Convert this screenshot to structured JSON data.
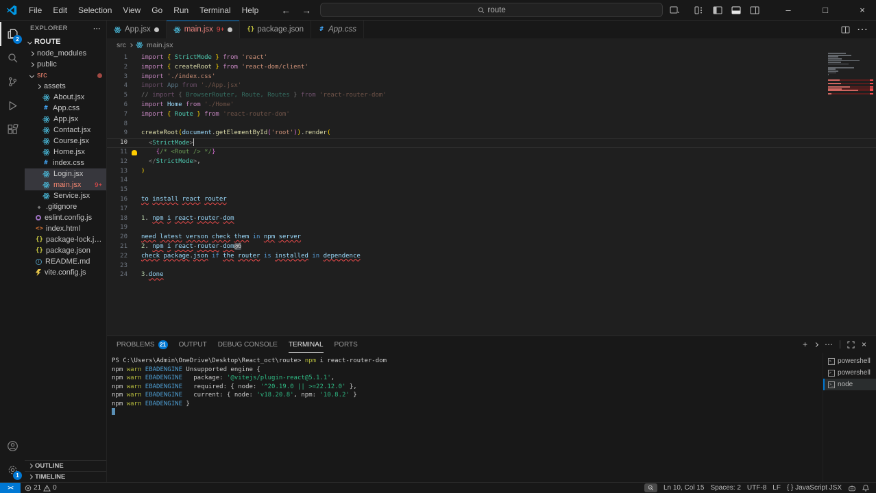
{
  "title_bar": {
    "menus": [
      "File",
      "Edit",
      "Selection",
      "View",
      "Go",
      "Run",
      "Terminal",
      "Help"
    ],
    "search_value": "route"
  },
  "activity_bar": {
    "explorer_badge": "2",
    "settings_badge": "1"
  },
  "sidebar": {
    "header": "EXPLORER",
    "root": "ROUTE",
    "files": [
      {
        "label": "node_modules",
        "icon": "chev",
        "indent": 0,
        "folder": true
      },
      {
        "label": "public",
        "icon": "chev",
        "indent": 0,
        "folder": true
      },
      {
        "label": "src",
        "icon": "chev-open",
        "indent": 0,
        "folder": true,
        "color": "red",
        "dot": true
      },
      {
        "label": "assets",
        "icon": "chev",
        "indent": 1,
        "folder": true
      },
      {
        "label": "About.jsx",
        "icon": "react",
        "indent": 1
      },
      {
        "label": "App.css",
        "icon": "css",
        "indent": 1
      },
      {
        "label": "App.jsx",
        "icon": "react",
        "indent": 1
      },
      {
        "label": "Contact.jsx",
        "icon": "react",
        "indent": 1
      },
      {
        "label": "Course.jsx",
        "icon": "react",
        "indent": 1
      },
      {
        "label": "Home.jsx",
        "icon": "react",
        "indent": 1
      },
      {
        "label": "index.css",
        "icon": "css",
        "indent": 1
      },
      {
        "label": "Login.jsx",
        "icon": "react",
        "indent": 1,
        "selected": true,
        "color": "red2"
      },
      {
        "label": "main.jsx",
        "icon": "react",
        "indent": 1,
        "selected": true,
        "color": "red",
        "badge": "9+"
      },
      {
        "label": "Service.jsx",
        "icon": "react",
        "indent": 1
      },
      {
        "label": ".gitignore",
        "icon": "git",
        "indent": 0
      },
      {
        "label": "eslint.config.js",
        "icon": "eslint",
        "indent": 0
      },
      {
        "label": "index.html",
        "icon": "html",
        "indent": 0
      },
      {
        "label": "package-lock.json",
        "icon": "json",
        "indent": 0
      },
      {
        "label": "package.json",
        "icon": "json",
        "indent": 0
      },
      {
        "label": "README.md",
        "icon": "md",
        "indent": 0
      },
      {
        "label": "vite.config.js",
        "icon": "vite",
        "indent": 0
      }
    ],
    "sections": [
      "OUTLINE",
      "TIMELINE"
    ]
  },
  "tabs": [
    {
      "label": "App.jsx",
      "icon": "react",
      "modified": true
    },
    {
      "label": "main.jsx",
      "icon": "react",
      "badge": "9+",
      "modified": true,
      "active": true,
      "error": true
    },
    {
      "label": "package.json",
      "icon": "json"
    },
    {
      "label": "App.css",
      "icon": "css",
      "preview": true
    }
  ],
  "breadcrumb": {
    "folder": "src",
    "file": "main.jsx"
  },
  "editor": {
    "lines": [
      {
        "n": 1,
        "s": [
          [
            "import ",
            "kw"
          ],
          [
            "{ ",
            "b1"
          ],
          [
            "StrictMode ",
            "cls"
          ],
          [
            "} ",
            "b1"
          ],
          [
            "from ",
            "kw"
          ],
          [
            "'react'",
            "str"
          ]
        ]
      },
      {
        "n": 2,
        "s": [
          [
            "import ",
            "kw"
          ],
          [
            "{ ",
            "b1"
          ],
          [
            "createRoot ",
            "fn"
          ],
          [
            "} ",
            "b1"
          ],
          [
            "from ",
            "kw"
          ],
          [
            "'react-dom/client'",
            "str"
          ]
        ]
      },
      {
        "n": 3,
        "s": [
          [
            "import ",
            "kw"
          ],
          [
            "'./index.css'",
            "str"
          ]
        ]
      },
      {
        "n": 4,
        "s": [
          [
            "import ",
            "kw dim"
          ],
          [
            "App ",
            "var dim"
          ],
          [
            "from ",
            "kw dim"
          ],
          [
            "'./App.jsx'",
            "str dim"
          ]
        ]
      },
      {
        "n": 5,
        "s": [
          [
            "// ",
            "p dim"
          ],
          [
            "import ",
            "kw dim"
          ],
          [
            "{ ",
            "p dim"
          ],
          [
            "BrowserRouter, Route, Routes",
            "cls dim"
          ],
          [
            " } ",
            "p dim"
          ],
          [
            "from ",
            "kw dim"
          ],
          [
            "'react-router-dom'",
            "str dim"
          ]
        ]
      },
      {
        "n": 6,
        "s": [
          [
            "import ",
            "kw"
          ],
          [
            "Home ",
            "var"
          ],
          [
            "from ",
            "kw"
          ],
          [
            "'./Home'",
            "str dim"
          ]
        ]
      },
      {
        "n": 7,
        "s": [
          [
            "import ",
            "kw"
          ],
          [
            "{ ",
            "b1"
          ],
          [
            "Route ",
            "cls"
          ],
          [
            "} ",
            "b1"
          ],
          [
            "from ",
            "kw"
          ],
          [
            "'react-router-dom'",
            "str dim"
          ]
        ]
      },
      {
        "n": 8,
        "s": []
      },
      {
        "n": 9,
        "s": [
          [
            "createRoot",
            "fn"
          ],
          [
            "(",
            "b1"
          ],
          [
            "document",
            "var"
          ],
          [
            ".",
            "p"
          ],
          [
            "getElementById",
            "fn"
          ],
          [
            "(",
            "b2"
          ],
          [
            "'root'",
            "str"
          ],
          [
            ")",
            "b2"
          ],
          [
            ")",
            "b1"
          ],
          [
            ".",
            "p"
          ],
          [
            "render",
            "fn"
          ],
          [
            "(",
            "b1"
          ]
        ]
      },
      {
        "n": 10,
        "cur": true,
        "caret": true,
        "s": [
          [
            "  ",
            "p"
          ],
          [
            "<",
            "tag"
          ],
          [
            "StrictMode",
            "cls"
          ],
          [
            ">",
            "tag"
          ]
        ]
      },
      {
        "n": 11,
        "bulb": true,
        "s": [
          [
            "    ",
            "p"
          ],
          [
            "{",
            "b2"
          ],
          [
            "/* ",
            "cm"
          ],
          [
            "<Rout /> ",
            "cm"
          ],
          [
            "*/",
            "cm"
          ],
          [
            "}",
            "b2"
          ]
        ]
      },
      {
        "n": 12,
        "s": [
          [
            "  ",
            "p"
          ],
          [
            "</",
            "tag"
          ],
          [
            "StrictMode",
            "cls"
          ],
          [
            ">",
            "tag"
          ],
          [
            ",",
            "p"
          ]
        ]
      },
      {
        "n": 13,
        "s": [
          [
            ")",
            "b1"
          ]
        ]
      },
      {
        "n": 14,
        "s": []
      },
      {
        "n": 15,
        "s": []
      },
      {
        "n": 16,
        "s": [
          [
            "to",
            "var sq"
          ],
          [
            " ",
            "p"
          ],
          [
            "install",
            "var sq"
          ],
          [
            " ",
            "p"
          ],
          [
            "react",
            "var sq"
          ],
          [
            " ",
            "p"
          ],
          [
            "router",
            "var sq"
          ]
        ]
      },
      {
        "n": 17,
        "s": []
      },
      {
        "n": 18,
        "s": [
          [
            "1",
            "num"
          ],
          [
            ". ",
            "p"
          ],
          [
            "npm",
            "var sq"
          ],
          [
            " ",
            "p"
          ],
          [
            "i",
            "var sq"
          ],
          [
            " ",
            "p"
          ],
          [
            "react",
            "var sq"
          ],
          [
            "-",
            "p"
          ],
          [
            "router",
            "var sq"
          ],
          [
            "-",
            "p"
          ],
          [
            "dom",
            "var sq"
          ]
        ]
      },
      {
        "n": 19,
        "s": []
      },
      {
        "n": 20,
        "s": [
          [
            "need",
            "var sq"
          ],
          [
            " ",
            "p"
          ],
          [
            "latest",
            "var sq"
          ],
          [
            " ",
            "p"
          ],
          [
            "verson",
            "var sq"
          ],
          [
            " ",
            "p"
          ],
          [
            "check",
            "var sq"
          ],
          [
            " ",
            "p"
          ],
          [
            "them",
            "var sq"
          ],
          [
            " ",
            "p"
          ],
          [
            "in",
            "ctrl"
          ],
          [
            " ",
            "p"
          ],
          [
            "npm",
            "var sq"
          ],
          [
            " ",
            "p"
          ],
          [
            "server",
            "var sq"
          ]
        ]
      },
      {
        "n": 21,
        "s": [
          [
            "2",
            "num"
          ],
          [
            ". ",
            "p"
          ],
          [
            "npm",
            "var sq"
          ],
          [
            " ",
            "p"
          ],
          [
            "i",
            "var sq"
          ],
          [
            " ",
            "p"
          ],
          [
            "react",
            "var sq"
          ],
          [
            "-",
            "p"
          ],
          [
            "router",
            "var sq"
          ],
          [
            "-",
            "p"
          ],
          [
            "dom",
            "var sq"
          ],
          [
            "@6",
            "hl"
          ]
        ]
      },
      {
        "n": 22,
        "s": [
          [
            "check",
            "var sq"
          ],
          [
            " ",
            "p"
          ],
          [
            "package",
            "var sq"
          ],
          [
            ".",
            "p"
          ],
          [
            "json",
            "var sq"
          ],
          [
            " ",
            "p"
          ],
          [
            "if",
            "ctrl"
          ],
          [
            " ",
            "p"
          ],
          [
            "the",
            "var sq"
          ],
          [
            " ",
            "p"
          ],
          [
            "router",
            "var sq"
          ],
          [
            " ",
            "p"
          ],
          [
            "is",
            "ctrl"
          ],
          [
            " ",
            "p"
          ],
          [
            "installed",
            "var sq"
          ],
          [
            " ",
            "p"
          ],
          [
            "in",
            "ctrl"
          ],
          [
            " ",
            "p"
          ],
          [
            "dependence",
            "var sq"
          ]
        ]
      },
      {
        "n": 23,
        "s": []
      },
      {
        "n": 24,
        "s": [
          [
            "3",
            "num"
          ],
          [
            ".",
            "p"
          ],
          [
            "done",
            "var sq"
          ]
        ]
      }
    ]
  },
  "panel": {
    "tabs": [
      {
        "label": "PROBLEMS",
        "badge": "21"
      },
      {
        "label": "OUTPUT"
      },
      {
        "label": "DEBUG CONSOLE"
      },
      {
        "label": "TERMINAL",
        "active": true
      },
      {
        "label": "PORTS"
      }
    ],
    "terminal_lines": [
      {
        "s": [
          [
            "PS C:\\Users\\Admin\\OneDrive\\Desktop\\React_oct\\route> ",
            "p"
          ],
          [
            "npm",
            "y"
          ],
          [
            " i react-router-dom",
            "p"
          ]
        ]
      },
      {
        "s": [
          [
            "npm ",
            "p"
          ],
          [
            "warn",
            "y"
          ],
          [
            " ",
            "p"
          ],
          [
            "EBADENGINE",
            "b"
          ],
          [
            " Unsupported engine {",
            "p"
          ]
        ]
      },
      {
        "s": [
          [
            "npm ",
            "p"
          ],
          [
            "warn",
            "y"
          ],
          [
            " ",
            "p"
          ],
          [
            "EBADENGINE",
            "b"
          ],
          [
            "   package: ",
            "p"
          ],
          [
            "'@vitejs/plugin-react@5.1.1'",
            "g"
          ],
          [
            ",",
            "p"
          ]
        ]
      },
      {
        "s": [
          [
            "npm ",
            "p"
          ],
          [
            "warn",
            "y"
          ],
          [
            " ",
            "p"
          ],
          [
            "EBADENGINE",
            "b"
          ],
          [
            "   required: { node: ",
            "p"
          ],
          [
            "'^20.19.0 || >=22.12.0'",
            "g"
          ],
          [
            " },",
            "p"
          ]
        ]
      },
      {
        "s": [
          [
            "npm ",
            "p"
          ],
          [
            "warn",
            "y"
          ],
          [
            " ",
            "p"
          ],
          [
            "EBADENGINE",
            "b"
          ],
          [
            "   current: { node: ",
            "p"
          ],
          [
            "'v18.20.8'",
            "g"
          ],
          [
            ", npm: ",
            "p"
          ],
          [
            "'10.8.2'",
            "g"
          ],
          [
            " }",
            "p"
          ]
        ]
      },
      {
        "s": [
          [
            "npm ",
            "p"
          ],
          [
            "warn",
            "y"
          ],
          [
            " ",
            "p"
          ],
          [
            "EBADENGINE",
            "b"
          ],
          [
            " }",
            "p"
          ]
        ]
      },
      {
        "cursor": true,
        "s": []
      }
    ],
    "terminals": [
      {
        "label": "powershell"
      },
      {
        "label": "powershell"
      },
      {
        "label": "node",
        "active": true
      }
    ]
  },
  "status_bar": {
    "errors": "21",
    "warnings": "0",
    "line_col": "Ln 10, Col 15",
    "spaces": "Spaces: 2",
    "encoding": "UTF-8",
    "eol": "LF",
    "language": "JavaScript JSX"
  }
}
